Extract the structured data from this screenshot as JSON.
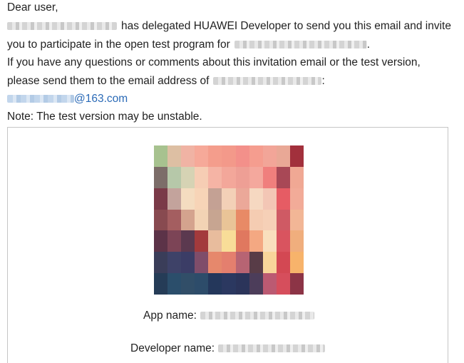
{
  "email": {
    "greeting": "Dear user,",
    "delegation_text": "has delegated HUAWEI Developer to send you this email and invite",
    "participate_text": "you to participate in the open test program for",
    "participate_end": ".",
    "questions_text": "If you have any questions or comments about this invitation email or the test version,",
    "send_text": "please send them to the email address of",
    "send_end": ":",
    "email_domain": "@163.com",
    "note": "Note: The test version may be unstable."
  },
  "app_card": {
    "app_name_label": "App name:",
    "developer_name_label": "Developer name:",
    "icon_grid": [
      [
        "#a7c28f",
        "#ddbfa3",
        "#f0b3a4",
        "#f6a999",
        "#f49d8c",
        "#f3998a",
        "#f3908a",
        "#f59d8f",
        "#f2a598",
        "#e9a896",
        "#a2303c"
      ],
      [
        "#7c6d69",
        "#b6c8a9",
        "#d6d3b4",
        "#f6cdb4",
        "#f5b4a5",
        "#f3a79a",
        "#ee9f95",
        "#f4a89d",
        "#f07f7d",
        "#a84856",
        "#f0a894"
      ],
      [
        "#7a3a48",
        "#c3a39c",
        "#f4dcc0",
        "#f7d4b7",
        "#c4a194",
        "#f3d0b7",
        "#eba899",
        "#f6d8c1",
        "#f3c6b5",
        "#e65c64",
        "#f2ab98"
      ],
      [
        "#884a50",
        "#a45e60",
        "#d4a38e",
        "#f2d3b4",
        "#c7a591",
        "#e9c497",
        "#e88a66",
        "#f5ccb2",
        "#f6d0b7",
        "#cf5a64",
        "#f2b696"
      ],
      [
        "#5c3348",
        "#7c4456",
        "#5b394f",
        "#a33a3c",
        "#e8bc9d",
        "#f8dd98",
        "#e0785f",
        "#f4a882",
        "#f9dfbd",
        "#d9545f",
        "#f0ae7d"
      ],
      [
        "#3a3d59",
        "#3e4268",
        "#3b3d66",
        "#7f4d6a",
        "#e6886c",
        "#e47f6e",
        "#b76473",
        "#583c47",
        "#f8d59a",
        "#d34853",
        "#f7b36b"
      ],
      [
        "#253c57",
        "#2b4e6b",
        "#314e68",
        "#2d4c6a",
        "#24375b",
        "#2b3860",
        "#2b345a",
        "#4c3d5a",
        "#bb5a72",
        "#d64e5c",
        "#8c3446"
      ]
    ]
  }
}
